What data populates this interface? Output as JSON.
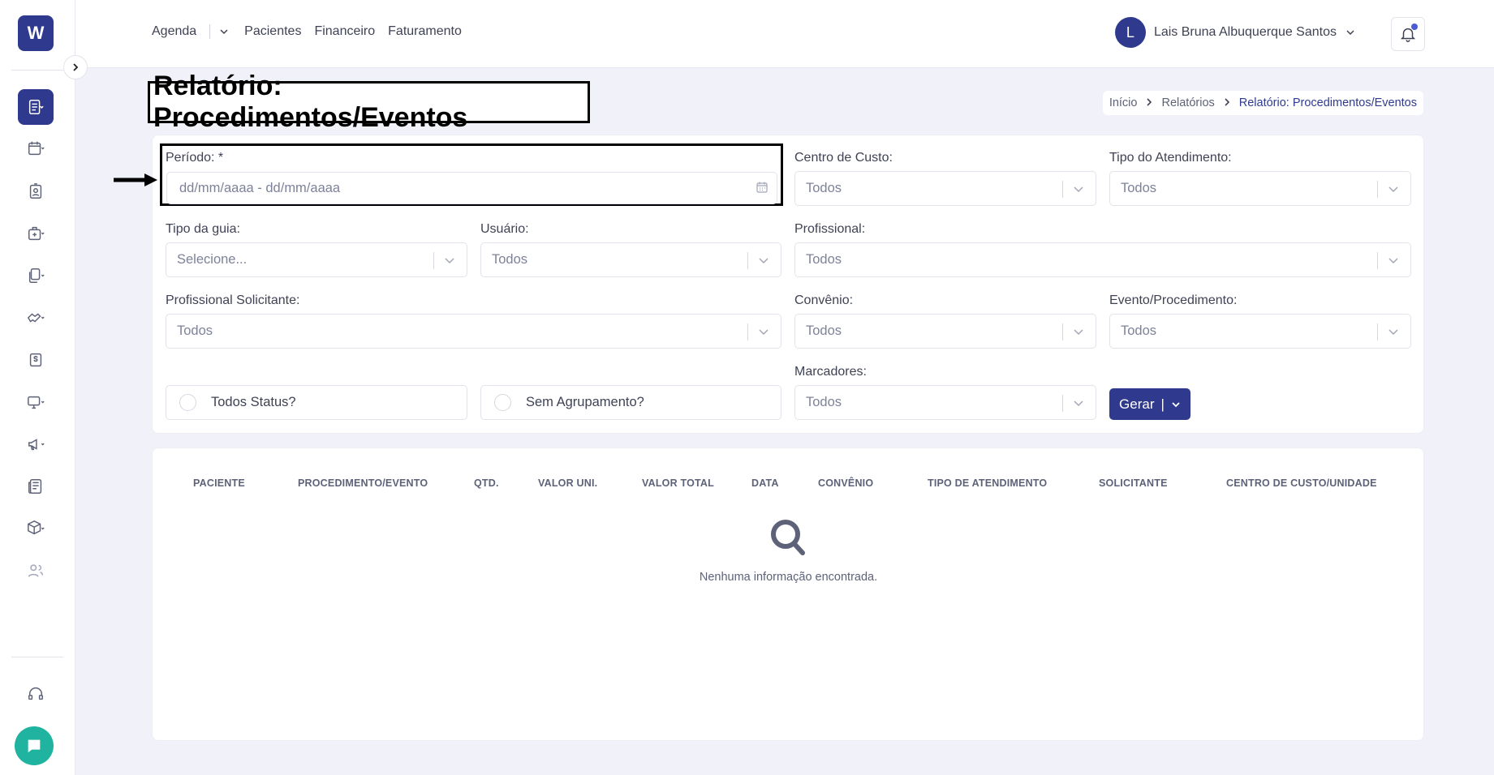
{
  "sidebar": {
    "logo_text": "W",
    "icons": [
      "reports-icon",
      "calendar-icon",
      "patient-card-icon",
      "medical-kit-icon",
      "documents-icon",
      "handshake-icon",
      "dollar-icon",
      "monitor-icon",
      "megaphone-icon",
      "newspaper-icon",
      "package-icon",
      "users-icon",
      "headset-icon",
      "chat-icon"
    ]
  },
  "topbar": {
    "nav": {
      "agenda": "Agenda",
      "pacientes": "Pacientes",
      "financeiro": "Financeiro",
      "faturamento": "Faturamento"
    },
    "user": {
      "initial": "L",
      "name": "Lais Bruna Albuquerque Santos"
    }
  },
  "page": {
    "title": "Relatório: Procedimentos/Eventos",
    "breadcrumb": [
      "Início",
      "Relatórios",
      "Relatório: Procedimentos/Eventos"
    ]
  },
  "form": {
    "periodo": {
      "label": "Período: *",
      "placeholder": "dd/mm/aaaa - dd/mm/aaaa"
    },
    "centro_custo": {
      "label": "Centro de Custo:",
      "value": "Todos"
    },
    "tipo_atendimento": {
      "label": "Tipo do Atendimento:",
      "value": "Todos"
    },
    "tipo_guia": {
      "label": "Tipo da guia:",
      "value": "Selecione..."
    },
    "usuario": {
      "label": "Usuário:",
      "value": "Todos"
    },
    "profissional": {
      "label": "Profissional:",
      "value": "Todos"
    },
    "profissional_solicitante": {
      "label": "Profissional Solicitante:",
      "value": "Todos"
    },
    "convenio": {
      "label": "Convênio:",
      "value": "Todos"
    },
    "evento_procedimento": {
      "label": "Evento/Procedimento:",
      "value": "Todos"
    },
    "marcadores": {
      "label": "Marcadores:",
      "value": "Todos"
    },
    "todos_status": "Todos Status?",
    "sem_agrupamento": "Sem Agrupamento?",
    "gerar": "Gerar"
  },
  "table": {
    "columns": [
      "PACIENTE",
      "PROCEDIMENTO/EVENTO",
      "QTD.",
      "VALOR UNI.",
      "VALOR TOTAL",
      "DATA",
      "CONVÊNIO",
      "TIPO DE ATENDIMENTO",
      "SOLICITANTE",
      "CENTRO DE CUSTO/UNIDADE"
    ],
    "empty_message": "Nenhuma informação encontrada."
  },
  "colors": {
    "primary": "#2f3a8f",
    "chat": "#20b39f",
    "background": "#f1f2f9"
  }
}
